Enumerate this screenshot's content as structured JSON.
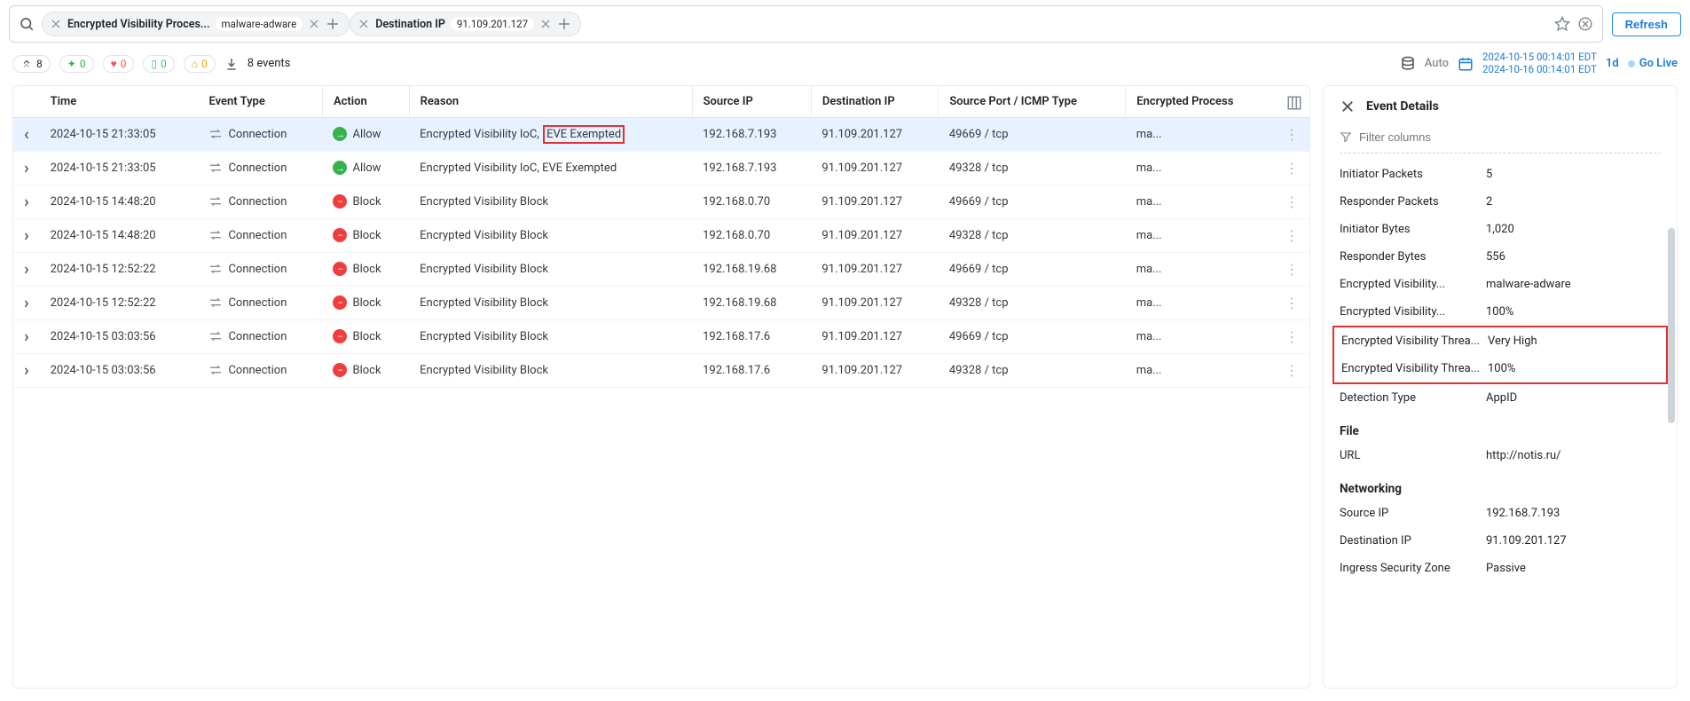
{
  "filters": [
    {
      "label": "Encrypted Visibility Proces...",
      "value": "malware-adware"
    },
    {
      "label": "Destination IP",
      "value": "91.109.201.127"
    }
  ],
  "refresh_label": "Refresh",
  "stats": {
    "arrow": "8",
    "green": "0",
    "red": "0",
    "doc": "0",
    "yellow": "0"
  },
  "events_count_label": "8 events",
  "auto_label": "Auto",
  "time_range": {
    "start": "2024-10-15 00:14:01 EDT",
    "end": "2024-10-16 00:14:01 EDT"
  },
  "duration_label": "1d",
  "golive_label": "Go Live",
  "columns": [
    "Time",
    "Event Type",
    "Action",
    "Reason",
    "Source IP",
    "Destination IP",
    "Source Port / ICMP Type",
    "Encrypted Process"
  ],
  "rows": [
    {
      "time": "2024-10-15 21:33:05",
      "etype": "Connection",
      "action": "Allow",
      "reason_prefix": "Encrypted Visibility IoC,",
      "reason_highlight": "EVE Exempted",
      "src": "192.168.7.193",
      "dst": "91.109.201.127",
      "port": "49669 / tcp",
      "proc": "ma...",
      "selected": true,
      "expanded": true
    },
    {
      "time": "2024-10-15 21:33:05",
      "etype": "Connection",
      "action": "Allow",
      "reason_prefix": "Encrypted Visibility IoC, EVE Exempted",
      "reason_highlight": "",
      "src": "192.168.7.193",
      "dst": "91.109.201.127",
      "port": "49328 / tcp",
      "proc": "ma..."
    },
    {
      "time": "2024-10-15 14:48:20",
      "etype": "Connection",
      "action": "Block",
      "reason_prefix": "Encrypted Visibility Block",
      "reason_highlight": "",
      "src": "192.168.0.70",
      "dst": "91.109.201.127",
      "port": "49669 / tcp",
      "proc": "ma..."
    },
    {
      "time": "2024-10-15 14:48:20",
      "etype": "Connection",
      "action": "Block",
      "reason_prefix": "Encrypted Visibility Block",
      "reason_highlight": "",
      "src": "192.168.0.70",
      "dst": "91.109.201.127",
      "port": "49328 / tcp",
      "proc": "ma..."
    },
    {
      "time": "2024-10-15 12:52:22",
      "etype": "Connection",
      "action": "Block",
      "reason_prefix": "Encrypted Visibility Block",
      "reason_highlight": "",
      "src": "192.168.19.68",
      "dst": "91.109.201.127",
      "port": "49669 / tcp",
      "proc": "ma..."
    },
    {
      "time": "2024-10-15 12:52:22",
      "etype": "Connection",
      "action": "Block",
      "reason_prefix": "Encrypted Visibility Block",
      "reason_highlight": "",
      "src": "192.168.19.68",
      "dst": "91.109.201.127",
      "port": "49328 / tcp",
      "proc": "ma..."
    },
    {
      "time": "2024-10-15 03:03:56",
      "etype": "Connection",
      "action": "Block",
      "reason_prefix": "Encrypted Visibility Block",
      "reason_highlight": "",
      "src": "192.168.17.6",
      "dst": "91.109.201.127",
      "port": "49669 / tcp",
      "proc": "ma..."
    },
    {
      "time": "2024-10-15 03:03:56",
      "etype": "Connection",
      "action": "Block",
      "reason_prefix": "Encrypted Visibility Block",
      "reason_highlight": "",
      "src": "192.168.17.6",
      "dst": "91.109.201.127",
      "port": "49328 / tcp",
      "proc": "ma..."
    }
  ],
  "details": {
    "title": "Event Details",
    "filter_placeholder": "Filter columns",
    "fields": [
      {
        "label": "Initiator Packets",
        "value": "5"
      },
      {
        "label": "Responder Packets",
        "value": "2"
      },
      {
        "label": "Initiator Bytes",
        "value": "1,020"
      },
      {
        "label": "Responder Bytes",
        "value": "556"
      },
      {
        "label": "Encrypted Visibility...",
        "value": "malware-adware"
      },
      {
        "label": "Encrypted Visibility...",
        "value": "100%"
      }
    ],
    "boxed_fields": [
      {
        "label": "Encrypted Visibility Threa...",
        "value": "Very High"
      },
      {
        "label": "Encrypted Visibility Threa...",
        "value": "100%"
      }
    ],
    "after_box_fields": [
      {
        "label": "Detection Type",
        "value": "AppID"
      }
    ],
    "section_file": "File",
    "file_fields": [
      {
        "label": "URL",
        "value": "http://notis.ru/"
      }
    ],
    "section_net": "Networking",
    "net_fields": [
      {
        "label": "Source IP",
        "value": "192.168.7.193"
      },
      {
        "label": "Destination IP",
        "value": "91.109.201.127"
      },
      {
        "label": "Ingress Security Zone",
        "value": "Passive"
      }
    ]
  }
}
